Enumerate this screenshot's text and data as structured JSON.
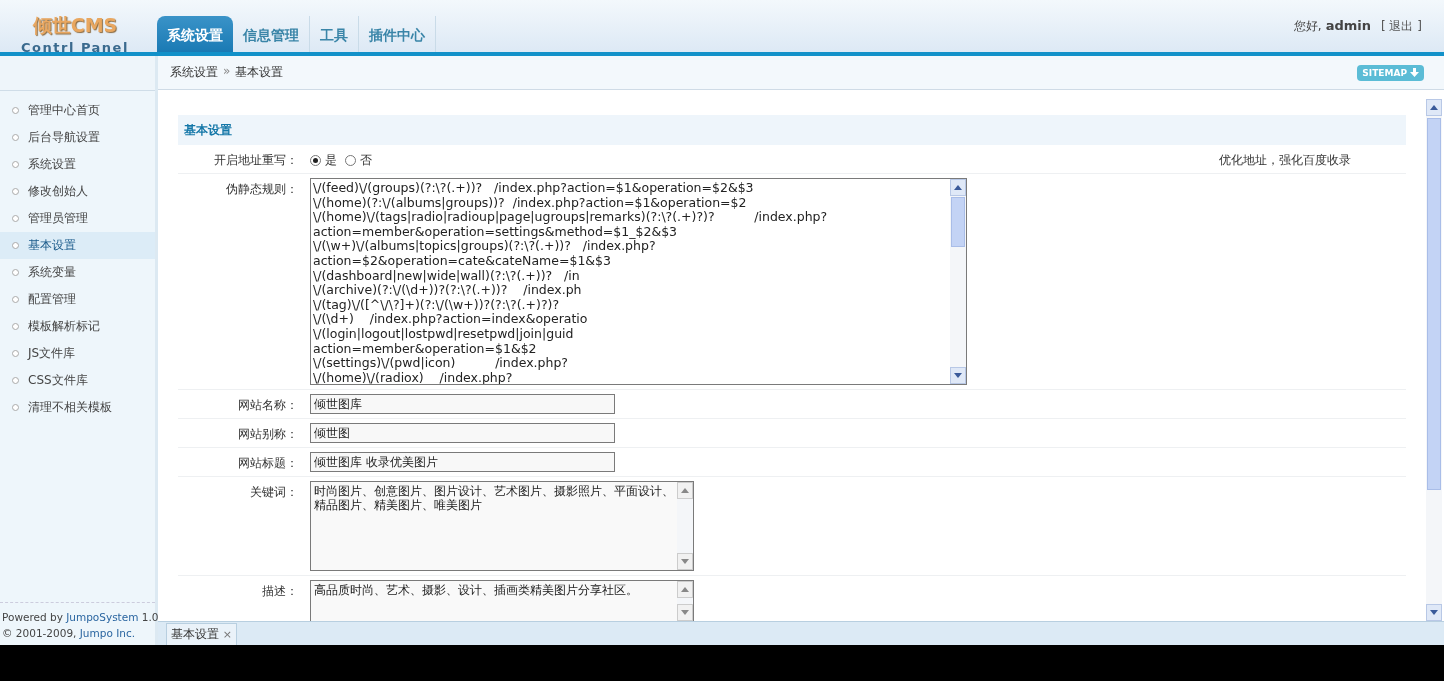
{
  "logo": {
    "title": "倾世CMS",
    "subtitle": "Contrl Panel"
  },
  "tabs": [
    {
      "label": "系统设置",
      "selected": true
    },
    {
      "label": "信息管理",
      "selected": false
    },
    {
      "label": "工具",
      "selected": false
    },
    {
      "label": "插件中心",
      "selected": false
    }
  ],
  "user": {
    "greeting": "您好,",
    "name": "admin",
    "logout": "[ 退出 ]"
  },
  "breadcrumb": {
    "parent": "系统设置",
    "separator": "»",
    "current": "基本设置"
  },
  "sitemap_button": "SITEMAP",
  "sidebar": {
    "items": [
      {
        "label": "管理中心首页",
        "selected": false
      },
      {
        "label": "后台导航设置",
        "selected": false
      },
      {
        "label": "系统设置",
        "selected": false
      },
      {
        "label": "修改创始人",
        "selected": false
      },
      {
        "label": "管理员管理",
        "selected": false
      },
      {
        "label": "基本设置",
        "selected": true
      },
      {
        "label": "系统变量",
        "selected": false
      },
      {
        "label": "配置管理",
        "selected": false
      },
      {
        "label": "模板解析标记",
        "selected": false
      },
      {
        "label": "JS文件库",
        "selected": false
      },
      {
        "label": "CSS文件库",
        "selected": false
      },
      {
        "label": "清理不相关模板",
        "selected": false
      }
    ],
    "footer": {
      "powered": "Powered by",
      "system_link": "JumpoSystem",
      "version": "1.0",
      "copyright": "© 2001-2009,",
      "company_link": "Jumpo Inc."
    }
  },
  "section_title": "基本设置",
  "form": [
    {
      "kind": "radio",
      "label": "开启地址重写：",
      "options": [
        {
          "label": "是",
          "selected": true
        },
        {
          "label": "否",
          "selected": false
        }
      ],
      "hint": "优化地址，强化百度收录"
    },
    {
      "kind": "code",
      "label": "伪静态规则：",
      "lines": [
        "\\/(feed)\\/(groups)(?:\\?(.+))?   /index.php?action=$1&operation=$2&$3",
        "\\/(home)(?:\\/(albums|groups))?  /index.php?action=$1&operation=$2",
        "\\/(home)\\/(tags|radio|radioup|page|ugroups|remarks)(?:\\?(.+)?)?          /index.php?",
        "action=member&operation=settings&method=$1_$2&$3",
        "\\/(\\w+)\\/(albums|topics|groups)(?:\\?(.+))?   /index.php?",
        "action=$2&operation=cate&cateName=$1&$3",
        "\\/(dashboard|new|wide|wall)(?:\\?(.+))?   /in",
        "\\/(archive)(?:\\/(\\d+))?(?:\\?(.+))?    /index.ph",
        "\\/(tag)\\/([^\\/\\?]+)(?:\\/(\\w+))?(?:\\?(.+)?)?",
        "\\/(\\d+)    /index.php?action=index&operatio",
        "\\/(login|logout|lostpwd|resetpwd|join|guid",
        "action=member&operation=$1&$2",
        "\\/(settings)\\/(pwd|icon)          /index.php?",
        "\\/(home)\\/(radiox)    /index.php?"
      ]
    },
    {
      "kind": "input",
      "label": "网站名称：",
      "value": "倾世图库"
    },
    {
      "kind": "input",
      "label": "网站别称：",
      "value": "倾世图"
    },
    {
      "kind": "input",
      "label": "网站标题：",
      "value": "倾世图库 收录优美图片"
    },
    {
      "kind": "textarea",
      "label": "关键词：",
      "value": "时尚图片、创意图片、图片设计、艺术图片、摄影照片、平面设计、精品图片、精美图片、唯美图片"
    },
    {
      "kind": "textarea",
      "label": "描述：",
      "value": "高品质时尚、艺术、摄影、设计、插画类精美图片分享社区。"
    }
  ],
  "bottom_tabs": [
    {
      "label": "基本设置",
      "close": "×"
    }
  ]
}
